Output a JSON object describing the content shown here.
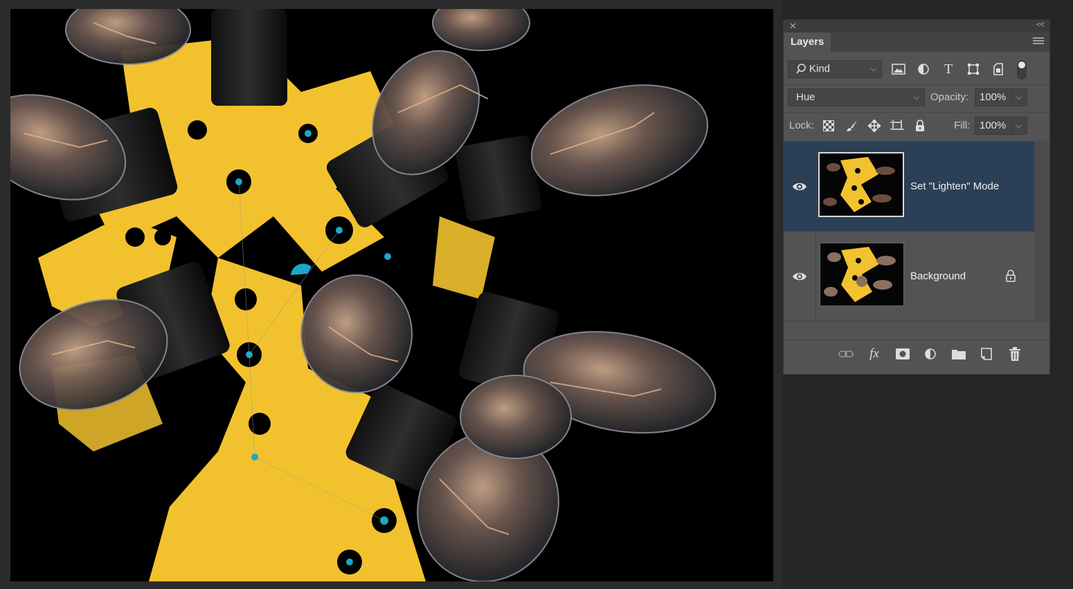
{
  "panel": {
    "title": "Layers",
    "close_icon": "close-icon",
    "collapse_icon": "double-chevron-left-icon",
    "menu_icon": "panel-menu-icon"
  },
  "filter": {
    "kind_label": "Kind",
    "icons": [
      "image-filter-icon",
      "adjustment-filter-icon",
      "type-filter-icon",
      "shape-filter-icon",
      "smart-object-filter-icon",
      "filter-toggle-icon"
    ]
  },
  "blend": {
    "mode": "Hue",
    "opacity_label": "Opacity:",
    "opacity_value": "100%"
  },
  "lock": {
    "label": "Lock:",
    "icons": [
      "lock-transparent-pixels-icon",
      "lock-image-pixels-icon",
      "lock-position-icon",
      "lock-artboard-icon",
      "lock-all-icon"
    ],
    "fill_label": "Fill:",
    "fill_value": "100%"
  },
  "layers": [
    {
      "name": "Set \"Lighten\" Mode",
      "visible": true,
      "selected": true,
      "locked": false
    },
    {
      "name": "Background",
      "visible": true,
      "selected": false,
      "locked": true
    }
  ],
  "bottom_icons": [
    "link-layers-icon",
    "fx-icon",
    "add-mask-icon",
    "new-adjustment-icon",
    "new-group-icon",
    "new-layer-icon",
    "trash-icon"
  ],
  "colors": {
    "selected_layer": "#2b3f57",
    "panel_bg": "#535353",
    "canvas_bg": "#000000",
    "accent_yellow": "#f2c22e",
    "accent_cyan": "#1aa7c9"
  }
}
